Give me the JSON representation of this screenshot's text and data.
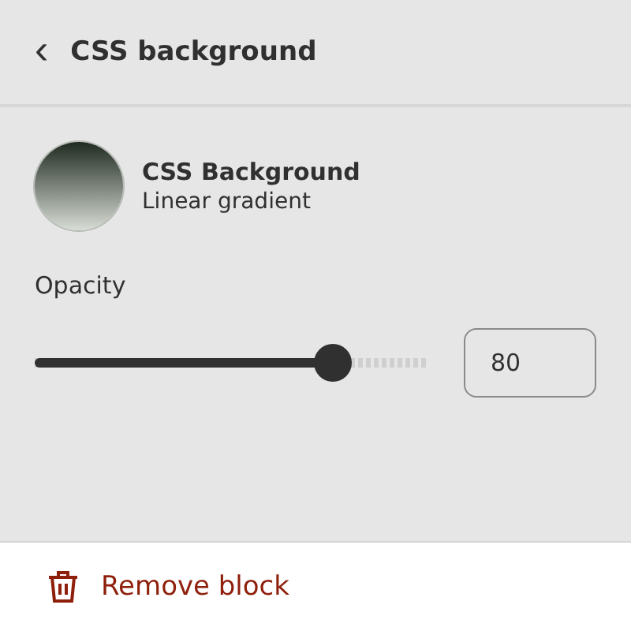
{
  "header": {
    "back": "‹",
    "title": "CSS background"
  },
  "block": {
    "title": "CSS Background",
    "subtitle": "Linear gradient"
  },
  "opacity": {
    "label": "Opacity",
    "level": 0.77,
    "value": "80"
  },
  "footer": {
    "action": "Remove block"
  }
}
